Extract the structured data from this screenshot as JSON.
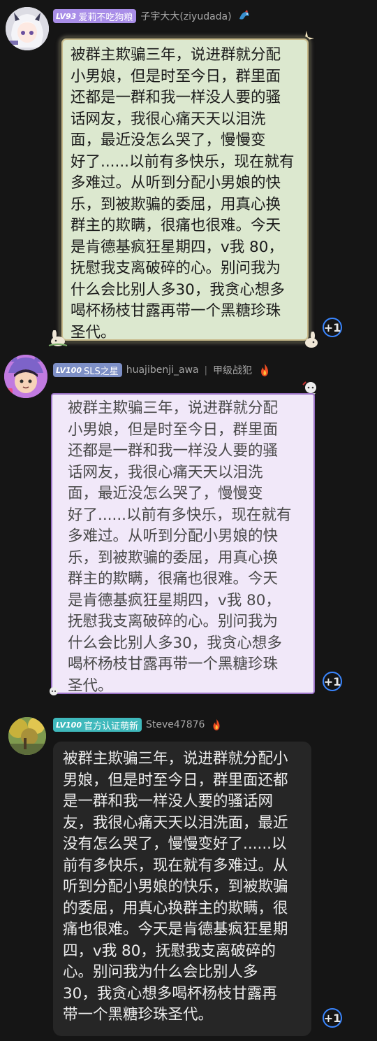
{
  "messages": [
    {
      "badge": {
        "level": "LV93",
        "title": "爱莉不吃狗粮",
        "color": "#a98ee8"
      },
      "username": "子宇大大(ziyudada)",
      "text": "被群主欺骗三年，说进群就分配\n小男娘，但是时至今日，群里面\n还都是一群和我一样没人要的骚\n话网友，我很心痛天天以泪洗\n面，最近没怎么哭了，慢慢变\n好了......以前有多快乐，现在就有\n多难过。从听到分配小男娘的快\n乐，到被欺骗的委屈，用真心换\n群主的欺瞒，很痛也很难。今天\n是肯德基疯狂星期四，v我 80，\n抚慰我支离破碎的心。别问我为\n什么会比别人多30，我贪心想多\n喝杯杨枝甘露再带一个黑糖珍珠\n圣代。",
      "plus": "+1"
    },
    {
      "badge": {
        "level": "LV100",
        "title": "SLS之星",
        "color": "#7d8fc6"
      },
      "username": "huajibenji_awa",
      "separator": "|",
      "title2": "甲级战犯",
      "text": "被群主欺骗三年，说进群就分配\n小男娘，但是时至今日，群里面\n还都是一群和我一样没人要的骚\n话网友，我很心痛天天以泪洗\n面，最近没怎么哭了，慢慢变\n好了......以前有多快乐，现在就有\n多难过。从听到分配小男娘的快\n乐，到被欺骗的委屈，用真心换\n群主的欺瞒，很痛也很难。今天\n是肯德基疯狂星期四，v我 80，\n抚慰我支离破碎的心。别问我为\n什么会比别人多30，我贪心想多\n喝杯杨枝甘露再带一个黑糖珍珠\n圣代。",
      "plus": "+1"
    },
    {
      "badge": {
        "level": "LV100",
        "title": "官方认证萌新",
        "color": "#3fb9bc"
      },
      "username": "Steve47876",
      "text": "被群主欺骗三年，说进群就分配小\n男娘，但是时至今日，群里面还都\n是一群和我一样没人要的骚话网\n友，我很心痛天天以泪洗面，最近\n没有怎么哭了，慢慢变好了......以\n前有多快乐，现在就有多难过。从\n听到分配小男娘的快乐，到被欺骗\n的委屈，用真心换群主的欺瞒，很\n痛也很难。今天是肯德基疯狂星期\n四，v我 80，抚慰我支离破碎的\n心。别问我为什么会比别人多\n30，我贪心想多喝杯杨枝甘露再\n带一个黑糖珍珠圣代。",
      "plus": "+1"
    }
  ]
}
